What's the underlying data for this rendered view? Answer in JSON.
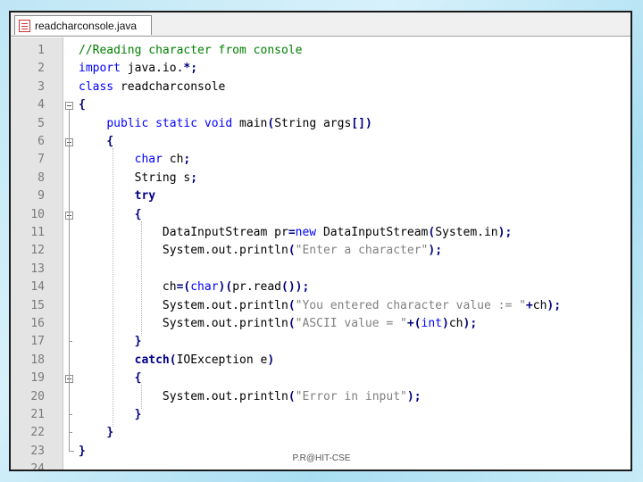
{
  "tab": {
    "title": "readcharconsole.java"
  },
  "lines": [
    {
      "n": "1",
      "code": "//Reading character from console"
    },
    {
      "n": "2",
      "code": "import java.io.*;"
    },
    {
      "n": "3",
      "code": "class readcharconsole"
    },
    {
      "n": "4",
      "code": "{"
    },
    {
      "n": "5",
      "code": "    public static void main(String args[])"
    },
    {
      "n": "6",
      "code": "    {"
    },
    {
      "n": "7",
      "code": "        char ch;"
    },
    {
      "n": "8",
      "code": "        String s;"
    },
    {
      "n": "9",
      "code": "        try"
    },
    {
      "n": "10",
      "code": "        {"
    },
    {
      "n": "11",
      "code": "            DataInputStream pr=new DataInputStream(System.in);"
    },
    {
      "n": "12",
      "code": "            System.out.println(\"Enter a character\");"
    },
    {
      "n": "13",
      "code": ""
    },
    {
      "n": "14",
      "code": "            ch=(char)(pr.read());"
    },
    {
      "n": "15",
      "code": "            System.out.println(\"You entered character value := \"+ch);"
    },
    {
      "n": "16",
      "code": "            System.out.println(\"ASCII value = \"+(int)ch);"
    },
    {
      "n": "17",
      "code": "        }"
    },
    {
      "n": "18",
      "code": "        catch(IOException e)"
    },
    {
      "n": "19",
      "code": "        {"
    },
    {
      "n": "20",
      "code": "            System.out.println(\"Error in input\");"
    },
    {
      "n": "21",
      "code": "        }"
    },
    {
      "n": "22",
      "code": "    }"
    },
    {
      "n": "23",
      "code": "}"
    },
    {
      "n": "24",
      "code": ""
    }
  ],
  "footer": "P.R@HIT-CSE"
}
